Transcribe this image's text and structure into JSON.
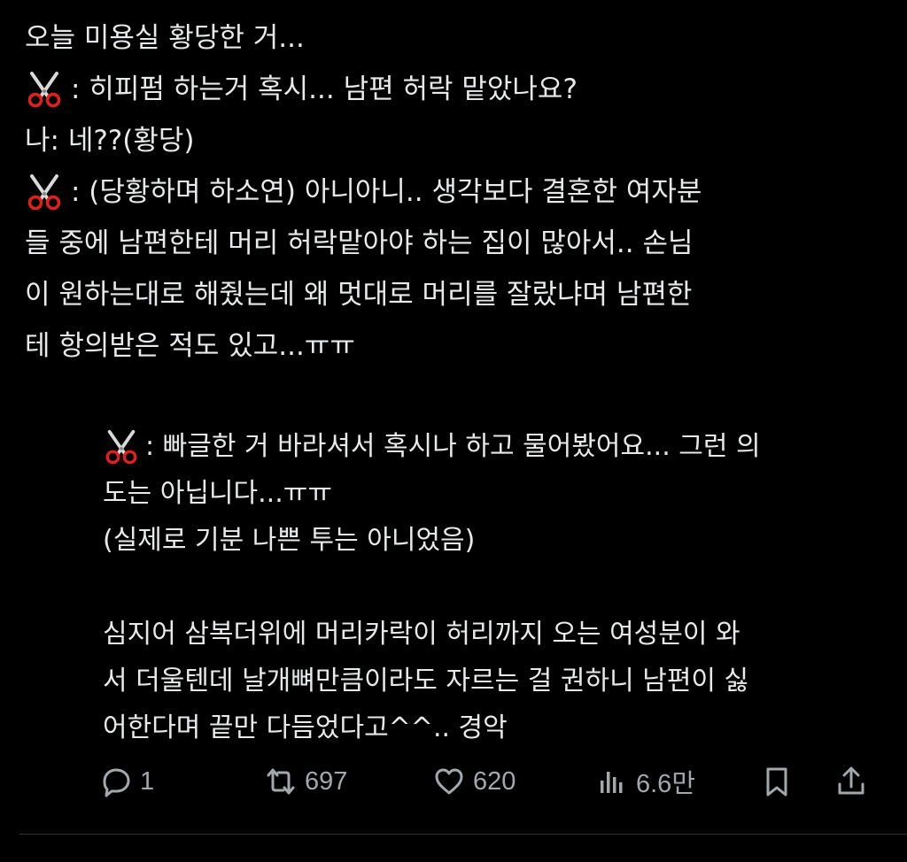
{
  "post": {
    "lines": [
      "오늘 미용실 황당한 거...",
      ": 히피펌 하는거 혹시... 남편 허락 맡았나요?",
      "나: 네??(황당)",
      ": (당황하며 하소연) 아니아니.. 생각보다 결혼한 여자분",
      "들 중에 남편한테 머리 허락맡아야 하는 집이 많아서.. 손님",
      "이 원하는대로 해줬는데 왜 멋대로 머리를 잘랐냐며 남편한",
      "테 항의받은 적도 있고...ㅠㅠ"
    ],
    "quote_lines": [
      ": 빠글한 거 바라셔서 혹시나 하고 물어봤어요... 그런 의",
      "도는 아닙니다...ㅠㅠ",
      "(실제로 기분 나쁜 투는 아니었음)",
      "심지어 삼복더위에 머리카락이 허리까지 오는 여성분이 와",
      "서 더울텐데 날개뼈만큼이라도 자르는 걸 권하니 남편이 싫",
      "어한다며 끝만 다듬었다고^^.. 경악"
    ]
  },
  "actions": {
    "reply_count": "1",
    "repost_count": "697",
    "like_count": "620",
    "views_count": "6.6만"
  },
  "icons": {
    "stylist": "scissors-icon",
    "reply": "reply-icon",
    "repost": "repost-icon",
    "like": "heart-icon",
    "views": "views-icon",
    "bookmark": "bookmark-icon",
    "share": "share-icon"
  },
  "colors": {
    "background": "#000000",
    "text": "#e7e9ea",
    "muted": "#a3a8ad",
    "scissor_handle": "#e0201b"
  }
}
